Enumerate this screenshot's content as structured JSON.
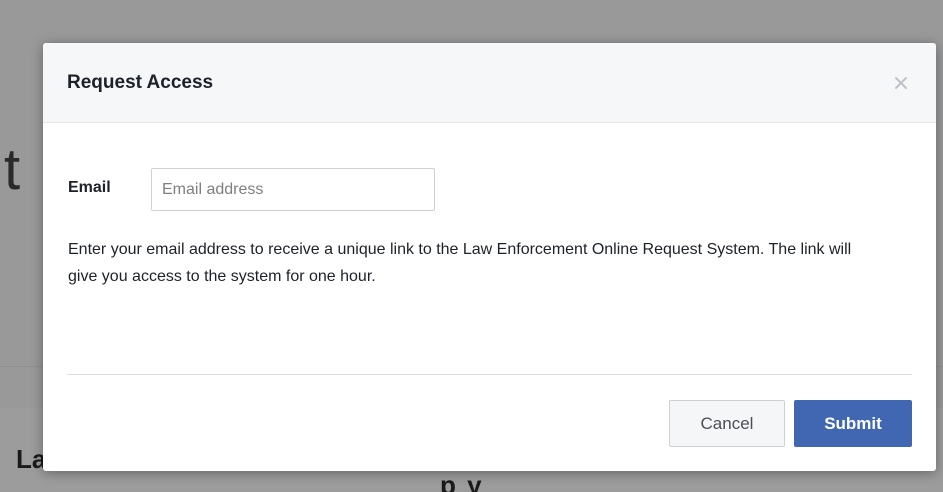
{
  "background": {
    "partial_letter": "t",
    "partial_heading": "La",
    "partial_tail": "p  y"
  },
  "modal": {
    "title": "Request Access",
    "close_glyph": "×",
    "email_label": "Email",
    "email_placeholder": "Email address",
    "email_value": "",
    "description": "Enter your email address to receive a unique link to the Law Enforcement Online Request System. The link will give you access to the system for one hour.",
    "cancel_label": "Cancel",
    "submit_label": "Submit"
  },
  "colors": {
    "submit_bg": "#4267b2",
    "header_bg": "#f6f7f9",
    "overlay_bg": "#999999"
  },
  "icons": {
    "close": "close-icon"
  }
}
